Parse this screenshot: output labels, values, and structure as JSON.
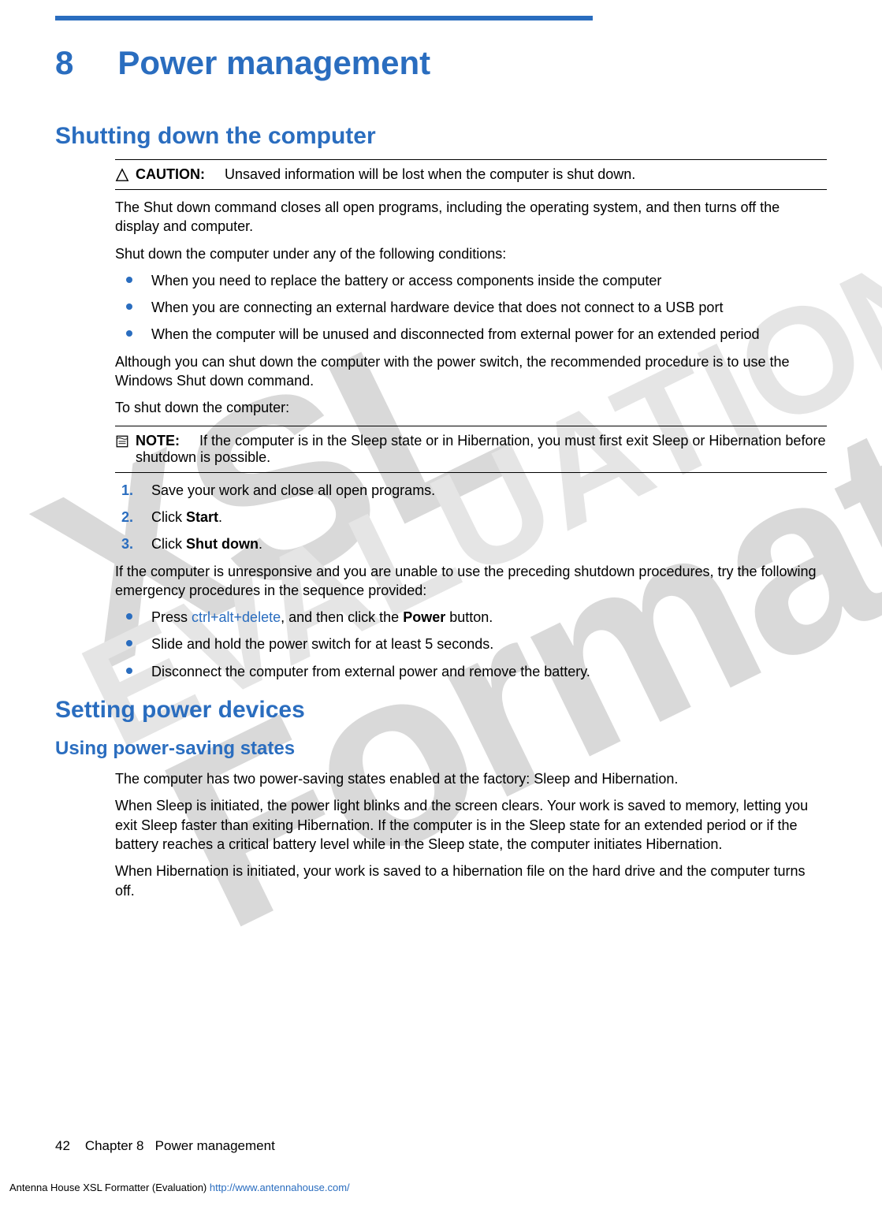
{
  "watermark": {
    "main": "XSL Formatter",
    "sub": "EVALUATION"
  },
  "chapter": {
    "number": "8",
    "title": "Power management"
  },
  "section1": {
    "title": "Shutting down the computer",
    "caution": {
      "label": "CAUTION:",
      "text": "Unsaved information will be lost when the computer is shut down."
    },
    "p1": "The Shut down command closes all open programs, including the operating system, and then turns off the display and computer.",
    "p2": "Shut down the computer under any of the following conditions:",
    "bullets1": [
      "When you need to replace the battery or access components inside the computer",
      "When you are connecting an external hardware device that does not connect to a USB port",
      "When the computer will be unused and disconnected from external power for an extended period"
    ],
    "p3": "Although you can shut down the computer with the power switch, the recommended procedure is to use the Windows Shut down command.",
    "p4": "To shut down the computer:",
    "note": {
      "label": "NOTE:",
      "text": "If the computer is in the Sleep state or in Hibernation, you must first exit Sleep or Hibernation before shutdown is possible."
    },
    "steps": {
      "s1": "Save your work and close all open programs.",
      "s2_pre": "Click ",
      "s2_bold": "Start",
      "s2_post": ".",
      "s3_pre": "Click ",
      "s3_bold": "Shut down",
      "s3_post": "."
    },
    "p5": "If the computer is unresponsive and you are unable to use the preceding shutdown procedures, try the following emergency procedures in the sequence provided:",
    "bullets2": {
      "b1_pre": "Press ",
      "b1_key": "ctrl+alt+delete",
      "b1_mid": ", and then click the ",
      "b1_bold": "Power",
      "b1_post": " button.",
      "b2": "Slide and hold the power switch for at least 5 seconds.",
      "b3": "Disconnect the computer from external power and remove the battery."
    }
  },
  "section2": {
    "title": "Setting power devices",
    "subsection": "Using power-saving states",
    "p1": "The computer has two power-saving states enabled at the factory: Sleep and Hibernation.",
    "p2": "When Sleep is initiated, the power light blinks and the screen clears. Your work is saved to memory, letting you exit Sleep faster than exiting Hibernation. If the computer is in the Sleep state for an extended period or if the battery reaches a critical battery level while in the Sleep state, the computer initiates Hibernation.",
    "p3": "When Hibernation is initiated, your work is saved to a hibernation file on the hard drive and the computer turns off."
  },
  "footer": {
    "page": "42",
    "chapter": "Chapter 8",
    "title": "Power management"
  },
  "eval": {
    "text": "Antenna House XSL Formatter (Evaluation)  ",
    "url": "http://www.antennahouse.com/"
  }
}
